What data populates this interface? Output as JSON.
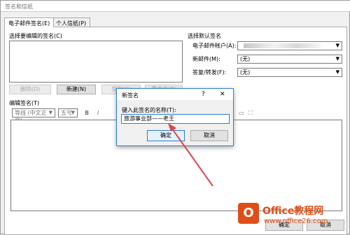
{
  "window": {
    "title": "签名和信纸"
  },
  "tabs": [
    {
      "label": "电子邮件签名(E)"
    },
    {
      "label": "个人信纸(P)"
    }
  ],
  "left": {
    "select_label": "选择要编辑的签名(C)",
    "buttons": {
      "delete": "删除(D)",
      "new": "新建(N)",
      "save": "保存(S)",
      "rename": "重命名(R)"
    },
    "edit_label": "编辑签名(T)"
  },
  "right": {
    "section_label": "选择默认签名",
    "account_label": "电子邮件帐户(A):",
    "new_message_label": "新邮件(M):",
    "new_message_value": "(无)",
    "reply_label": "答复/转发(F):",
    "reply_value": "(无)"
  },
  "format_toolbar": {
    "font": "等线 (中文正文)",
    "size": "五号",
    "bold": "B",
    "italic": "I"
  },
  "bottom_buttons": {
    "ok": "确定",
    "cancel": "取消"
  },
  "dialog": {
    "title": "新签名",
    "help": "?",
    "close": "✕",
    "prompt": "键入此签名的名称(T):",
    "input_value": "旅游事业部——老王",
    "ok": "确定",
    "cancel": "取消"
  },
  "watermark": {
    "logo_letter": "O",
    "brand": "Office教程网",
    "url": "www.office26.com"
  },
  "colors": {
    "accent": "#2b7fd6",
    "arrow": "#e0434b",
    "brand": "#e04e18"
  }
}
